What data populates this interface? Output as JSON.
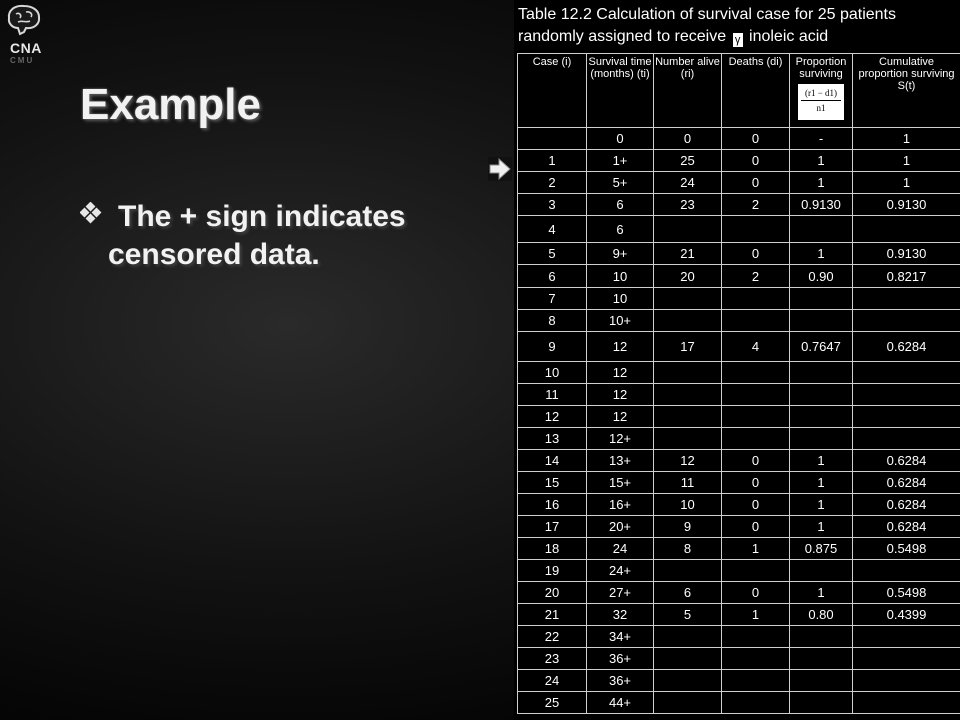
{
  "logo": {
    "icon": "brain-icon",
    "text": "CNA",
    "subtext": "CMU"
  },
  "slide": {
    "title": "Example",
    "bullet_icon": "diamond-bullet-icon",
    "bullet_text": "The + sign indicates censored data."
  },
  "pointer_icon": "right-arrow-icon",
  "table": {
    "caption_part1": "Table 12.2 Calculation of survival case for 25 patients randomly assigned to receive",
    "caption_glyph": "γ",
    "caption_part2": "inoleic acid",
    "headers": [
      "Case (i)",
      "Survival time (months) (ti)",
      "Number alive (ri)",
      "Deaths (di)",
      "Proportion surviving",
      "Cumulative proportion surviving S(t)"
    ],
    "formula_numerator": "(r1 − d1)",
    "formula_denominator": "n1",
    "rows": [
      [
        "",
        "0",
        "0",
        "0",
        "-",
        "1"
      ],
      [
        "1",
        "1+",
        "25",
        "0",
        "1",
        "1"
      ],
      [
        "2",
        "5+",
        "24",
        "0",
        "1",
        "1"
      ],
      [
        "3",
        "6",
        "23",
        "2",
        "0.9130",
        "0.9130"
      ],
      [
        "4",
        "6",
        "",
        "",
        "",
        ""
      ],
      [
        "5",
        "9+",
        "21",
        "0",
        "1",
        "0.9130"
      ],
      [
        "6",
        "10",
        "20",
        "2",
        "0.90",
        "0.8217"
      ],
      [
        "7",
        "10",
        "",
        "",
        "",
        ""
      ],
      [
        "8",
        "10+",
        "",
        "",
        "",
        ""
      ],
      [
        "9",
        "12",
        "17",
        "4",
        "0.7647",
        "0.6284"
      ],
      [
        "10",
        "12",
        "",
        "",
        "",
        ""
      ],
      [
        "11",
        "12",
        "",
        "",
        "",
        ""
      ],
      [
        "12",
        "12",
        "",
        "",
        "",
        ""
      ],
      [
        "13",
        "12+",
        "",
        "",
        "",
        ""
      ],
      [
        "14",
        "13+",
        "12",
        "0",
        "1",
        "0.6284"
      ],
      [
        "15",
        "15+",
        "11",
        "0",
        "1",
        "0.6284"
      ],
      [
        "16",
        "16+",
        "10",
        "0",
        "1",
        "0.6284"
      ],
      [
        "17",
        "20+",
        "9",
        "0",
        "1",
        "0.6284"
      ],
      [
        "18",
        "24",
        "8",
        "1",
        "0.875",
        "0.5498"
      ],
      [
        "19",
        "24+",
        "",
        "",
        "",
        ""
      ],
      [
        "20",
        "27+",
        "6",
        "0",
        "1",
        "0.5498"
      ],
      [
        "21",
        "32",
        "5",
        "1",
        "0.80",
        "0.4399"
      ],
      [
        "22",
        "34+",
        "",
        "",
        "",
        ""
      ],
      [
        "23",
        "36+",
        "",
        "",
        "",
        ""
      ],
      [
        "24",
        "36+",
        "",
        "",
        "",
        ""
      ],
      [
        "25",
        "44+",
        "",
        "",
        "",
        ""
      ]
    ]
  }
}
